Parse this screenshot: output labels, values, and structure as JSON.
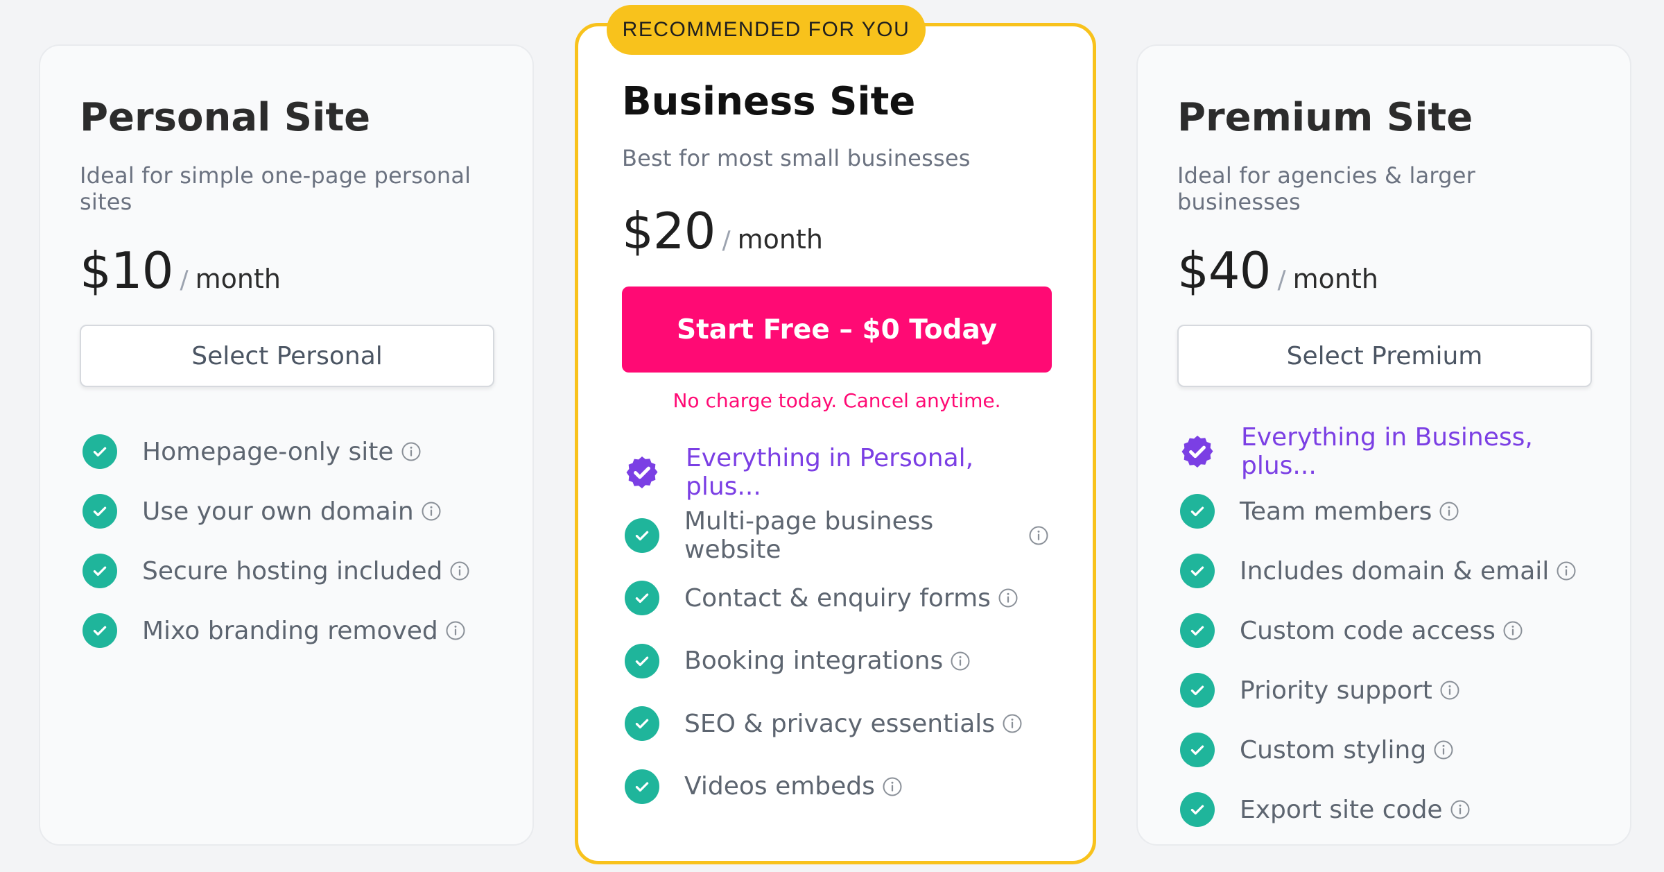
{
  "plans": {
    "personal": {
      "title": "Personal Site",
      "subtitle": "Ideal for simple one-page personal sites",
      "price": "$10",
      "slash": "/",
      "period": "month",
      "button": "Select Personal",
      "features": [
        {
          "label": "Homepage-only site",
          "icon": "check-icon",
          "info": true
        },
        {
          "label": "Use your own domain",
          "icon": "check-icon",
          "info": true
        },
        {
          "label": "Secure hosting included",
          "icon": "check-icon",
          "info": true
        },
        {
          "label": "Mixo branding removed",
          "icon": "check-icon",
          "info": true
        }
      ]
    },
    "business": {
      "badge": "RECOMMENDED FOR YOU",
      "title": "Business Site",
      "subtitle": "Best for most small businesses",
      "price": "$20",
      "slash": "/",
      "period": "month",
      "button": "Start Free – $0 Today",
      "note": "No charge today. Cancel anytime.",
      "features": [
        {
          "label": "Everything in Personal, plus...",
          "icon": "badge-check-icon",
          "info": false
        },
        {
          "label": "Multi-page business website",
          "icon": "check-icon",
          "info": true
        },
        {
          "label": "Contact & enquiry forms",
          "icon": "check-icon",
          "info": true
        },
        {
          "label": "Booking integrations",
          "icon": "check-icon",
          "info": true
        },
        {
          "label": "SEO & privacy essentials",
          "icon": "check-icon",
          "info": true
        },
        {
          "label": "Videos embeds",
          "icon": "check-icon",
          "info": true
        }
      ]
    },
    "premium": {
      "title": "Premium Site",
      "subtitle": "Ideal for agencies & larger businesses",
      "price": "$40",
      "slash": "/",
      "period": "month",
      "button": "Select Premium",
      "features": [
        {
          "label": "Everything in Business, plus...",
          "icon": "badge-check-icon",
          "info": false
        },
        {
          "label": "Team members",
          "icon": "check-icon",
          "info": true
        },
        {
          "label": "Includes domain & email",
          "icon": "check-icon",
          "info": true
        },
        {
          "label": "Custom code access",
          "icon": "check-icon",
          "info": true
        },
        {
          "label": "Priority support",
          "icon": "check-icon",
          "info": true
        },
        {
          "label": "Custom styling",
          "icon": "check-icon",
          "info": true
        },
        {
          "label": "Export site code",
          "icon": "check-icon",
          "info": true
        }
      ]
    }
  },
  "colors": {
    "accent_pink": "#ff0a74",
    "highlight_yellow": "#f8c21c",
    "check_green": "#1fb59b",
    "plus_purple": "#7b3fe4"
  }
}
